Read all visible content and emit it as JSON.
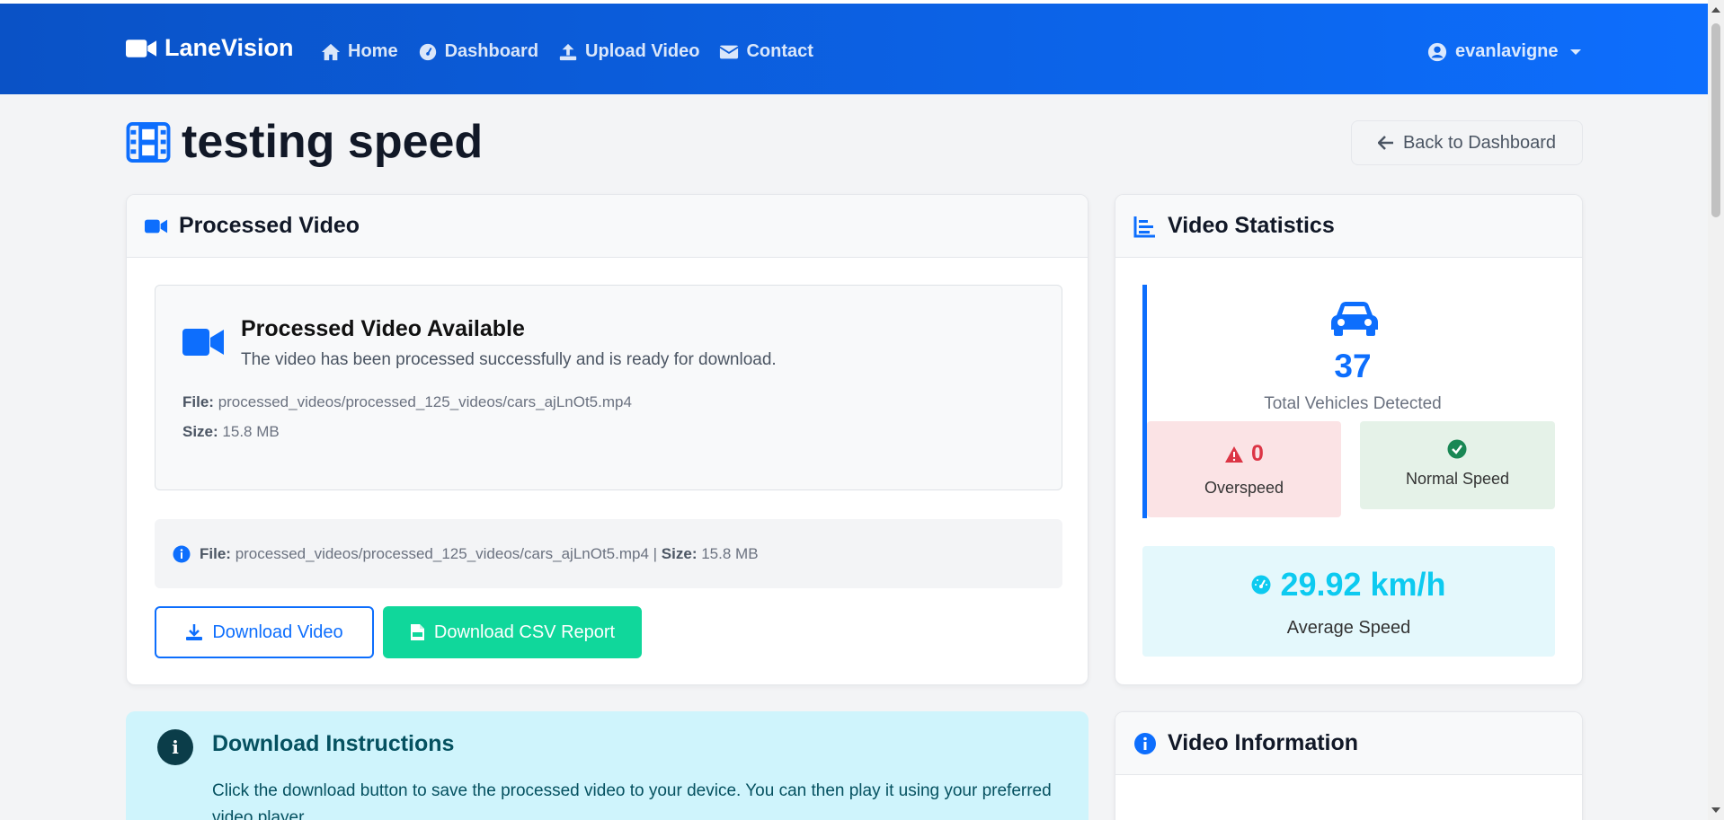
{
  "nav": {
    "brand": "LaneVision",
    "links": [
      {
        "label": "Home",
        "icon": "home-icon"
      },
      {
        "label": "Dashboard",
        "icon": "gauge-icon"
      },
      {
        "label": "Upload Video",
        "icon": "upload-icon"
      },
      {
        "label": "Contact",
        "icon": "envelope-icon"
      }
    ],
    "user": "evanlavigne"
  },
  "page": {
    "title": "testing speed",
    "back_label": "Back to Dashboard"
  },
  "video_card": {
    "header": "Processed Video",
    "avail_title": "Processed Video Available",
    "avail_text": "The video has been processed successfully and is ready for download.",
    "file_label": "File:",
    "file_value": "processed_videos/processed_125_videos/cars_ajLnOt5.mp4",
    "size_label": "Size:",
    "size_value": "15.8 MB",
    "info_file_label": "File:",
    "info_file_value": "processed_videos/processed_125_videos/cars_ajLnOt5.mp4 |",
    "info_size_label": "Size:",
    "info_size_value": "15.8 MB",
    "download_video": "Download Video",
    "download_csv": "Download CSV Report"
  },
  "stats": {
    "header": "Video Statistics",
    "total_vehicles": "37",
    "total_label": "Total Vehicles Detected",
    "overspeed_value": "0",
    "overspeed_label": "Overspeed",
    "normal_label": "Normal Speed",
    "avg_speed": "29.92 km/h",
    "avg_label": "Average Speed"
  },
  "instructions": {
    "title": "Download Instructions",
    "text": "Click the download button to save the processed video to your device. You can then play it using your preferred video player."
  },
  "video_info": {
    "header": "Video Information"
  },
  "colors": {
    "primary": "#0d6efd",
    "success": "#10d79b",
    "danger": "#dc3545",
    "info": "#0dcaf0"
  }
}
